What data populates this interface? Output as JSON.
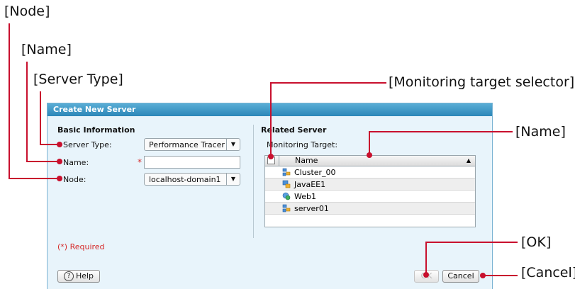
{
  "callouts": {
    "node": "[Node]",
    "name_left": "[Name]",
    "server_type": "[Server Type]",
    "monitoring_selector": "[Monitoring target selector]",
    "name_right": "[Name]",
    "ok": "[OK]",
    "cancel": "[Cancel]"
  },
  "dialog": {
    "title": "Create New Server",
    "basic_info": {
      "heading": "Basic Information",
      "server_type_label": "Server Type:",
      "server_type_value": "Performance Tracer",
      "name_label": "Name:",
      "name_value": "",
      "required_star": "*",
      "node_label": "Node:",
      "node_value": "localhost-domain1"
    },
    "related_server": {
      "heading": "Related Server",
      "monitoring_label": "Monitoring Target:",
      "table": {
        "column_name": "Name",
        "sort_indicator": "▲",
        "rows": [
          {
            "name": "Cluster_00",
            "icon": "cluster-icon"
          },
          {
            "name": "JavaEE1",
            "icon": "javaee-server-icon"
          },
          {
            "name": "Web1",
            "icon": "web-server-icon"
          },
          {
            "name": "server01",
            "icon": "cluster-icon"
          }
        ]
      }
    },
    "required_note": "(*) Required",
    "buttons": {
      "help": "Help",
      "help_glyph": "?",
      "ok": "OK",
      "cancel": "Cancel"
    }
  },
  "colors": {
    "annotation": "#c8102e",
    "dialog_bg": "#e8f4fb",
    "titlebar": "#2b86b8",
    "required": "#d62b2b"
  }
}
